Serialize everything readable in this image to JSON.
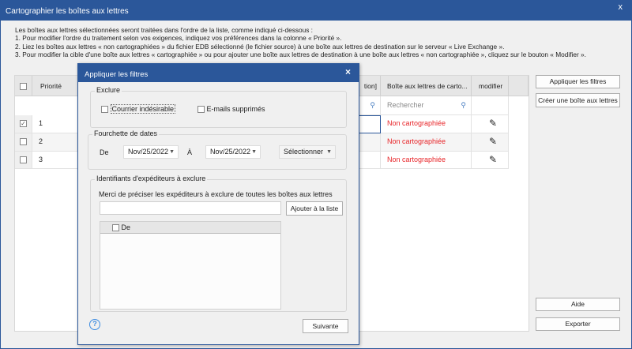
{
  "window": {
    "title": "Cartographier les boîtes aux lettres",
    "close": "x"
  },
  "instructions": [
    "Les boîtes aux lettres sélectionnées seront traitées dans l'ordre de la liste, comme indiqué ci-dessous :",
    "1. Pour modifier l'ordre du traitement selon vos exigences, indiquez vos préférences dans la colonne « Priorité ».",
    "2. Liez les boîtes aux lettres « non cartographiées » du fichier EDB sélectionné (le fichier source) à une boîte aux lettres de destination sur le serveur « Live Exchange ».",
    "3. Pour modifier la cible d'une boîte aux lettres « cartographiée » ou pour ajouter une boîte aux lettres de destination à une boîte aux lettres « non cartographiée », cliquez sur le bouton « Modifier »."
  ],
  "table": {
    "columns": {
      "priority": "Priorité",
      "hidden_partial": "tion]",
      "mapped": "Boîte aux lettres de carto...",
      "modify": "modifier"
    },
    "search_placeholder": "Rechercher",
    "rows": [
      {
        "priority": "1",
        "checked": true,
        "mapped": "Non cartographiée"
      },
      {
        "priority": "2",
        "checked": false,
        "mapped": "Non cartographiée"
      },
      {
        "priority": "3",
        "checked": false,
        "mapped": "Non cartographiée"
      }
    ],
    "status_color": "#e8262a"
  },
  "buttons": {
    "apply_filters": "Appliquer les filtres",
    "create_mailbox": "Créer une boîte aux lettres",
    "help": "Aide",
    "export": "Exporter"
  },
  "dialog": {
    "title": "Appliquer les filtres",
    "close": "×",
    "exclude": {
      "label": "Exclure",
      "junk": "Courrier indésirable",
      "deleted": "E-mails supprimés"
    },
    "dates": {
      "label": "Fourchette de dates",
      "from_label": "De",
      "from": "Nov/25/2022",
      "to_label": "À",
      "to": "Nov/25/2022",
      "select": "Sélectionner"
    },
    "senders": {
      "label": "Identifiants d'expéditeurs à exclure",
      "hint": "Merci de préciser les expéditeurs à exclure de toutes les boîtes aux lettres",
      "input": "",
      "add": "Ajouter à la liste",
      "list_col": "De"
    },
    "help_icon": "?",
    "next": "Suivante"
  }
}
